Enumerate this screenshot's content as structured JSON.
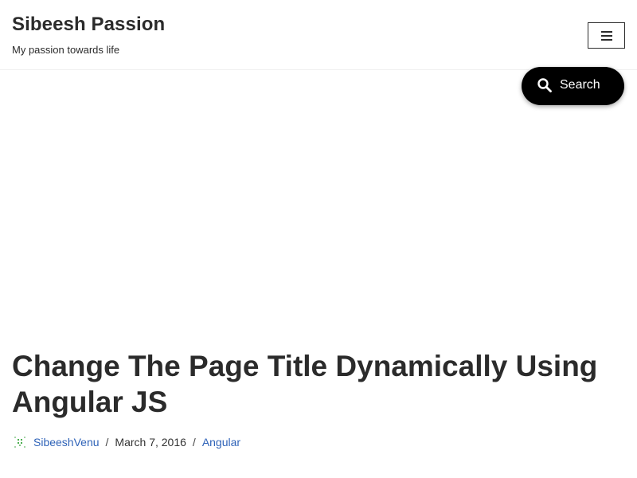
{
  "header": {
    "site_title": "Sibeesh Passion",
    "tagline": "My passion towards life"
  },
  "menu_toggle": {
    "icon": "hamburger-menu-icon"
  },
  "search": {
    "label": "Search",
    "icon": "search-icon"
  },
  "post": {
    "title": "Change The Page Title Dynamically Using Angular JS",
    "author": "SibeeshVenu",
    "separator": "/",
    "date": "March 7, 2016",
    "category": "Angular"
  },
  "colors": {
    "link": "#2f63b8",
    "search_bg": "#000000",
    "avatar_green": "#4caf50"
  }
}
